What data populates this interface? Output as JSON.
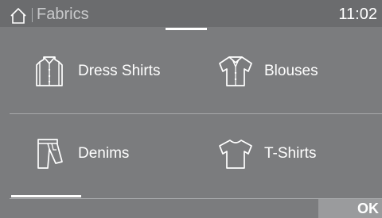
{
  "header": {
    "title": "Fabrics",
    "time": "11:02",
    "home_icon": "home-icon"
  },
  "fabrics": [
    {
      "label": "Dress Shirts",
      "icon": "dress-shirt-icon"
    },
    {
      "label": "Blouses",
      "icon": "blouse-icon"
    },
    {
      "label": "Denims",
      "icon": "denim-icon"
    },
    {
      "label": "T-Shirts",
      "icon": "t-shirt-icon"
    }
  ],
  "footer": {
    "ok_label": "OK"
  }
}
